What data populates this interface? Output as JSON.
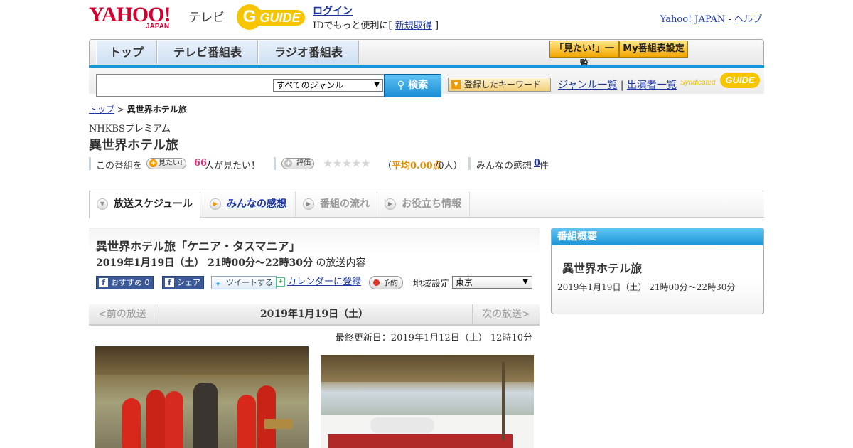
{
  "header": {
    "logo_text": "YAHOO!",
    "logo_sub": "JAPAN",
    "logo_tv": "テレビ",
    "gguide_logo": "GUIDE",
    "login_link": "ログイン",
    "login_desc_prefix": "IDでもっと便利に[",
    "signup_link": "新規取得",
    "login_desc_suffix": "]",
    "yahoo_japan_link": "Yahoo! JAPAN",
    "separator": " - ",
    "help_link": "ヘルプ"
  },
  "nav": {
    "tabs": [
      "トップ",
      "テレビ番組表",
      "ラジオ番組表"
    ],
    "want_list_button": "「見たい!」一覧",
    "my_schedule_button": "My番組表設定"
  },
  "search": {
    "query": "",
    "genre_selected": "すべてのジャンル",
    "submit_label": "検索",
    "keyword_button": "登録したキーワード",
    "genre_list_link": "ジャンル一覧",
    "link_separator": "|",
    "performer_list_link": "出演者一覧",
    "syndicated_label": "Syndicated",
    "syndicated_logo": "GUIDE"
  },
  "breadcrumb": {
    "home": "トップ",
    "separator": " > ",
    "current": "異世界ホテル旅"
  },
  "program": {
    "station": "NHKBSプレミアム",
    "title": "異世界ホテル旅",
    "want_prefix": "この番組を",
    "want_button": "見たい!",
    "want_count": "66",
    "want_suffix": "人が見たい！",
    "rate_button": "評価",
    "stars": "★★★★★",
    "rating_open": "（",
    "rating_label": "平均0.00点",
    "rating_count": "/0人）",
    "reviews_label": "みんなの感想",
    "reviews_count": "0",
    "reviews_suffix": "件"
  },
  "content_tabs": [
    {
      "label": "放送スケジュール",
      "state": "active"
    },
    {
      "label": "みんなの感想",
      "state": "link"
    },
    {
      "label": "番組の流れ",
      "state": "disabled"
    },
    {
      "label": "お役立ち情報",
      "state": "disabled"
    }
  ],
  "episode": {
    "heading": "異世界ホテル旅「ケニア・タスマニア」",
    "datetime": "2019年1月19日（土） 21時00分～22時30分",
    "datetime_suffix": " の放送内容",
    "fb_recommend": "おすすめ",
    "fb_count": "0",
    "fb_share": "シェア",
    "tweet": "ツイートする",
    "calendar": "カレンダーに登録",
    "reserve": "予約",
    "region_label": "地域設定",
    "region_value": "東京"
  },
  "date_nav": {
    "prev": "<前の放送",
    "current": "2019年1月19日（土）",
    "next": "次の放送>"
  },
  "last_updated": "最終更新日：2019年1月12日（土） 12時10分",
  "sidebar": {
    "header": "番組概要",
    "title": "異世界ホテル旅",
    "datetime": "2019年1月19日（土） 21時00分～22時30分"
  },
  "colors": {
    "yahoo_red": "#d4002f",
    "gguide_yellow": "#f7c600",
    "nav_blue": "#1896db",
    "link_blue": "#1c36a4",
    "want_count_pink": "#e0307a",
    "rating_orange": "#e38b00"
  }
}
